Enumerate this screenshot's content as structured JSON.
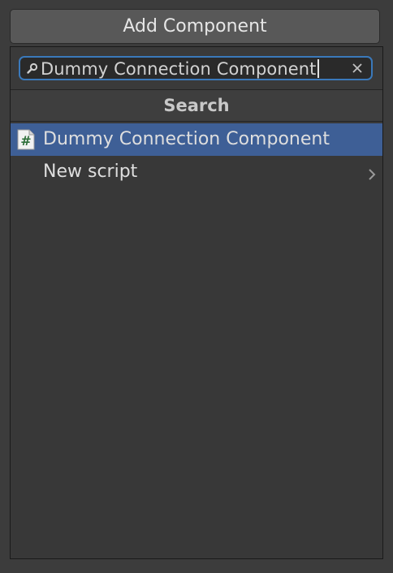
{
  "add_component": {
    "label": "Add Component"
  },
  "search": {
    "value": "Dummy Connection Component",
    "clear_icon": "close-icon",
    "search_icon": "search-icon"
  },
  "header": {
    "title": "Search"
  },
  "results": [
    {
      "label": "Dummy Connection Component",
      "icon": "csharp-script-icon",
      "selected": true
    },
    {
      "label": "New script",
      "icon": "chevron-right-icon",
      "selected": false
    }
  ],
  "colors": {
    "selection": "#3e5f96",
    "focus_border": "#3a79bb",
    "panel_bg": "#383838"
  }
}
